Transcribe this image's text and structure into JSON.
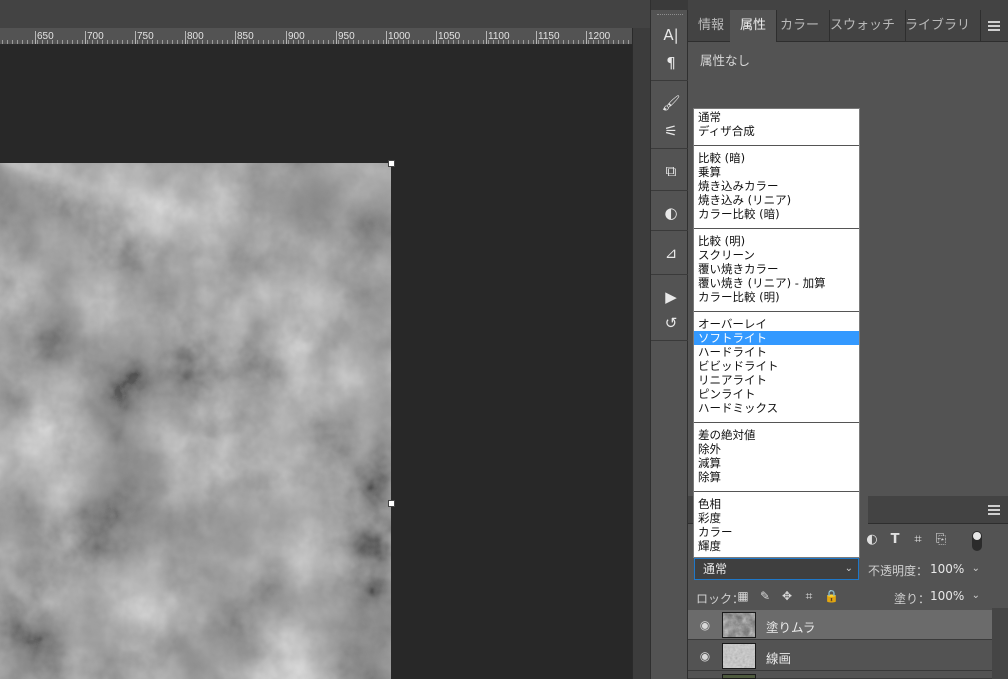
{
  "ruler": {
    "labels": [
      "650",
      "700",
      "750",
      "800",
      "850",
      "900",
      "950",
      "1000",
      "1050",
      "1100",
      "1150",
      "1200"
    ]
  },
  "toolstrip": {
    "tools": [
      {
        "name": "character-icon",
        "glyph": "A|"
      },
      {
        "name": "paragraph-icon",
        "glyph": "¶"
      },
      {
        "name": "brushes-icon",
        "glyph": "🖌"
      },
      {
        "name": "brush-settings-icon",
        "glyph": "⚟"
      },
      {
        "name": "clone-source-icon",
        "glyph": "⧉"
      },
      {
        "name": "adjustments-icon",
        "glyph": "◐"
      },
      {
        "name": "paths-icon",
        "glyph": "⊿"
      },
      {
        "name": "play-actions-icon",
        "glyph": "▶"
      },
      {
        "name": "history-icon",
        "glyph": "↺"
      }
    ]
  },
  "panel": {
    "tabs": [
      "情報",
      "属性",
      "カラー",
      "スウォッチ",
      "ライブラリ"
    ],
    "active_tab": "属性",
    "properties_text": "属性なし"
  },
  "blend_menu": {
    "groups": [
      [
        "通常",
        "ディザ合成"
      ],
      [
        "比較 (暗)",
        "乗算",
        "焼き込みカラー",
        "焼き込み (リニア)",
        "カラー比較 (暗)"
      ],
      [
        "比較 (明)",
        "スクリーン",
        "覆い焼きカラー",
        "覆い焼き (リニア) - 加算",
        "カラー比較 (明)"
      ],
      [
        "オーバーレイ",
        "ソフトライト",
        "ハードライト",
        "ビビッドライト",
        "リニアライト",
        "ピンライト",
        "ハードミックス"
      ],
      [
        "差の絶対値",
        "除外",
        "減算",
        "除算"
      ],
      [
        "色相",
        "彩度",
        "カラー",
        "輝度"
      ]
    ],
    "highlighted": "ソフトライト"
  },
  "layers": {
    "blend_mode": "通常",
    "opacity_label": "不透明度：",
    "opacity_value": "100%",
    "lock_label": "ロック：",
    "fill_label": "塗り：",
    "fill_value": "100%",
    "items": [
      {
        "name": "塗りムラ",
        "selected": true
      },
      {
        "name": "線画",
        "selected": false
      }
    ]
  }
}
